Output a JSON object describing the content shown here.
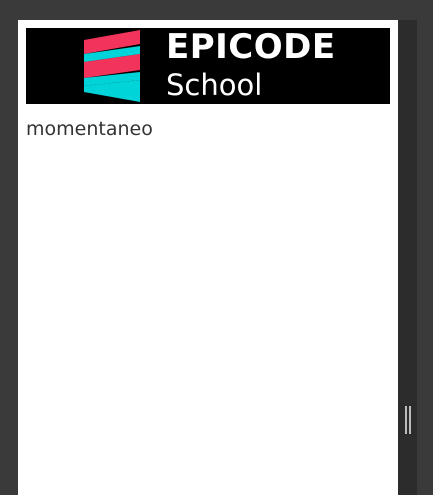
{
  "logo": {
    "title": "EPICODE",
    "subtitle": "School",
    "colors": {
      "background": "#000000",
      "red": "#f2335b",
      "cyan": "#00d4d8",
      "text": "#ffffff"
    }
  },
  "content": {
    "text": "momentaneo"
  },
  "icons": {
    "resize_grip": "resize-grip-icon"
  }
}
